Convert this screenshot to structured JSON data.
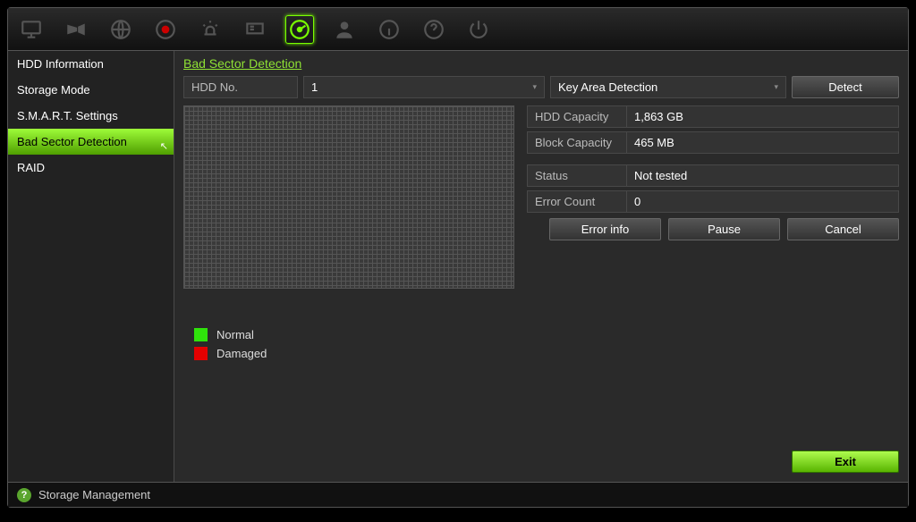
{
  "sidebar": {
    "items": [
      {
        "label": "HDD Information"
      },
      {
        "label": "Storage Mode"
      },
      {
        "label": "S.M.A.R.T. Settings"
      },
      {
        "label": "Bad Sector Detection"
      },
      {
        "label": "RAID"
      }
    ]
  },
  "page": {
    "title": "Bad Sector Detection",
    "hdd_no_label": "HDD No.",
    "hdd_no_value": "1",
    "detection_mode": "Key Area Detection",
    "detect_btn": "Detect"
  },
  "info": {
    "hdd_capacity_label": "HDD Capacity",
    "hdd_capacity_value": "1,863 GB",
    "block_capacity_label": "Block Capacity",
    "block_capacity_value": "465 MB",
    "status_label": "Status",
    "status_value": "Not tested",
    "error_count_label": "Error Count",
    "error_count_value": "0"
  },
  "buttons": {
    "error_info": "Error info",
    "pause": "Pause",
    "cancel": "Cancel",
    "exit": "Exit"
  },
  "legend": {
    "normal": "Normal",
    "damaged": "Damaged"
  },
  "statusbar": {
    "text": "Storage Management"
  }
}
